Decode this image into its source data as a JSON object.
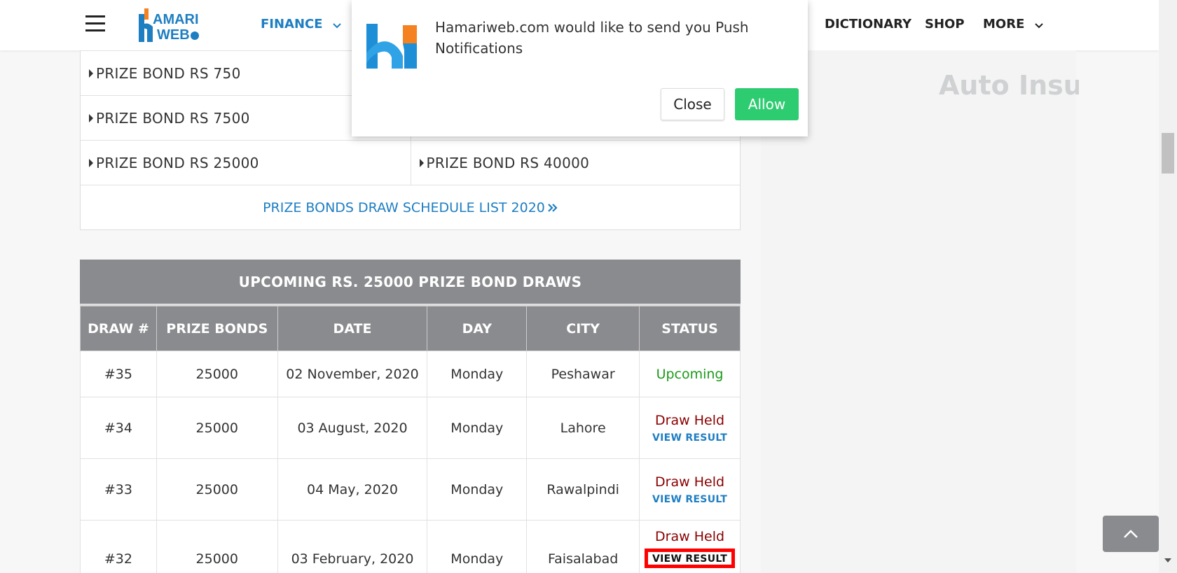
{
  "nav": {
    "logo_text_top": "AMARI",
    "logo_text_bottom": "WEB",
    "finance": "FINANCE",
    "dictionary": "DICTIONARY",
    "shop": "SHOP",
    "more": "MORE"
  },
  "links": {
    "rows": [
      [
        "PRIZE BOND RS 750",
        ""
      ],
      [
        "PRIZE BOND RS 7500",
        ""
      ],
      [
        "PRIZE BOND RS 25000",
        "PRIZE BOND RS 40000"
      ]
    ],
    "schedule": "PRIZE BONDS DRAW SCHEDULE LIST 2020"
  },
  "draws": {
    "title": "UPCOMING RS. 25000 PRIZE BOND DRAWS",
    "headers": [
      "DRAW #",
      "PRIZE BONDS",
      "DATE",
      "DAY",
      "CITY",
      "STATUS"
    ],
    "rows": [
      {
        "draw": "#35",
        "bonds": "25000",
        "date": "02 November, 2020",
        "day": "Monday",
        "city": "Peshawar",
        "status": "Upcoming",
        "link": ""
      },
      {
        "draw": "#34",
        "bonds": "25000",
        "date": "03 August, 2020",
        "day": "Monday",
        "city": "Lahore",
        "status": "Draw Held",
        "link": "VIEW RESULT"
      },
      {
        "draw": "#33",
        "bonds": "25000",
        "date": "04 May, 2020",
        "day": "Monday",
        "city": "Rawalpindi",
        "status": "Draw Held",
        "link": "VIEW RESULT"
      },
      {
        "draw": "#32",
        "bonds": "25000",
        "date": "03 February, 2020",
        "day": "Monday",
        "city": "Faisalabad",
        "status": "Draw Held",
        "link": "VIEW RESULT"
      }
    ]
  },
  "sidebar": {
    "ad_text": "Auto Insur"
  },
  "popup": {
    "message": "Hamariweb.com would like to send you Push Notifications",
    "close": "Close",
    "allow": "Allow"
  },
  "colors": {
    "accent": "#1e7ec2",
    "header_gray": "#8a8b8e",
    "allow_green": "#2ecc71",
    "highlight_red": "#ff0000"
  }
}
